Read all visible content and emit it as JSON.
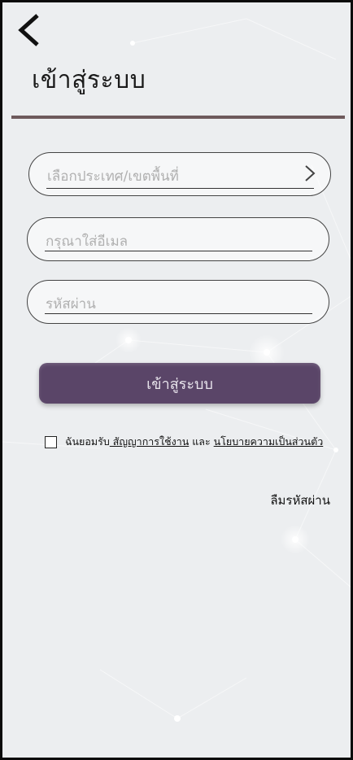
{
  "header": {
    "title": "เข้าสู่ระบบ"
  },
  "form": {
    "region_placeholder": "เลือกประเทศ/เขตพื้นที่",
    "email_placeholder": "กรุณาใส่อีเมล",
    "password_placeholder": "รหัสผ่าน"
  },
  "login_button": {
    "label": "เข้าสู่ระบบ"
  },
  "agreement": {
    "prefix": "ฉันยอมรับ",
    "terms_link": " สัญญาการใช้งาน",
    "conjunction": " และ ",
    "privacy_link": "นโยบายความเป็นส่วนตัว"
  },
  "forgot_password": "ลืมรหัสผ่าน",
  "colors": {
    "button": "#5a4568",
    "divider": "#6e5a5c",
    "background": "#eceef0"
  }
}
